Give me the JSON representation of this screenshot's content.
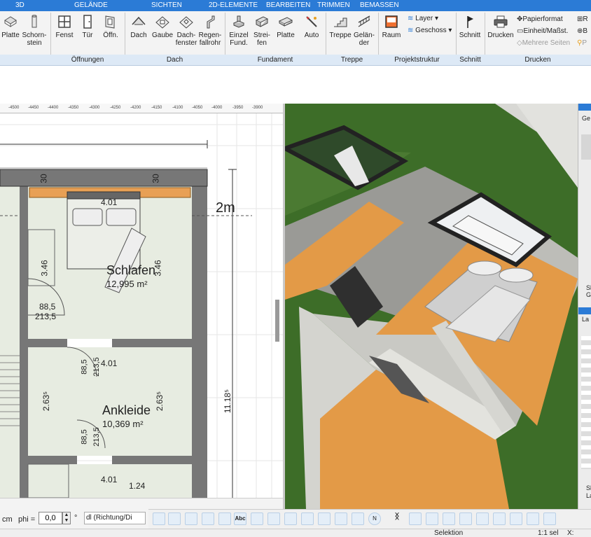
{
  "menu_tabs": [
    "3D",
    "GELÄNDE",
    "SICHTEN",
    "2D-ELEMENTE",
    "BEARBEITEN",
    "TRIMMEN",
    "BEMASSEN"
  ],
  "ribbon": {
    "buttons": [
      {
        "label": "Platte",
        "icon": "slab-icon"
      },
      {
        "label": "Schorn-\nstein",
        "icon": "chimney-icon"
      },
      {
        "label": "Fenst",
        "icon": "window-icon"
      },
      {
        "label": "Tür",
        "icon": "door-icon"
      },
      {
        "label": "Öffn.",
        "icon": "opening-icon"
      },
      {
        "label": "Dach",
        "icon": "roof-icon"
      },
      {
        "label": "Gaube",
        "icon": "dormer-icon"
      },
      {
        "label": "Dach-\nfenster",
        "icon": "roof-window-icon"
      },
      {
        "label": "Regen-\nfallrohr",
        "icon": "downpipe-icon"
      },
      {
        "label": "Einzel\nFund.",
        "icon": "single-foundation-icon"
      },
      {
        "label": "Strei-\nfen",
        "icon": "strip-foundation-icon"
      },
      {
        "label": "Platte",
        "icon": "foundation-slab-icon"
      },
      {
        "label": "Auto",
        "icon": "auto-icon"
      },
      {
        "label": "Treppe",
        "icon": "stairs-icon"
      },
      {
        "label": "Gelän-\nder",
        "icon": "railing-icon"
      },
      {
        "label": "Raum",
        "icon": "room-icon"
      },
      {
        "label": "Schnitt",
        "icon": "section-icon"
      },
      {
        "label": "Drucken",
        "icon": "printer-icon"
      }
    ],
    "small": {
      "layer": "Layer ▾",
      "geschoss": "Geschoss ▾",
      "papierformat": "Papierformat",
      "einheit": "Einheit/Maßst.",
      "mehrere_seiten": "Mehrere Seiten",
      "r": "R",
      "b": "B",
      "p": "P"
    },
    "groups": [
      "Öffnungen",
      "Dach",
      "Fundament",
      "Treppe",
      "Projektstruktur",
      "Schnitt",
      "Drucken"
    ]
  },
  "ruler_ticks": [
    "-4500",
    "-4450",
    "-4400",
    "-4350",
    "-4300",
    "-4250",
    "-4200",
    "-4150",
    "-4100",
    "-4050",
    "-4000",
    "-3950",
    "-3900"
  ],
  "plan": {
    "room1_name": "Schlafen",
    "room1_area": "12,995 m²",
    "room2_name": "Ankleide",
    "room2_area": "10,369 m²",
    "dims": {
      "d30a": "30",
      "d30b": "30",
      "d401a": "4.01",
      "d346a": "3.46",
      "d346b": "3.46",
      "d885a": "88,5",
      "d2135a": "213,5",
      "d885b": "88,5",
      "d2135b": "213,5",
      "d401b": "4.01",
      "d2635a": "2.63⁵",
      "d2635b": "2.63⁵",
      "d885c": "88,5",
      "d2135c": "213,5",
      "d401c": "4.01",
      "d124": "1.24",
      "d1118": "11.18⁵",
      "d2m": "2m"
    }
  },
  "bottom": {
    "unit": "cm",
    "phi_label": "phi =",
    "phi_value": "0,0",
    "deg": "°",
    "dl_select": "dl (Richtung/Di"
  },
  "rpanel": {
    "ge": "Ge",
    "la": "La",
    "s1": "Sl",
    "g1": "G",
    "s2": "Sl",
    "l2": "La"
  },
  "status": {
    "mode": "Selektion",
    "scale": "1:1 sel",
    "x": "X:"
  },
  "colors": {
    "accent": "#2b7bd6",
    "floor_wood": "#e39a47",
    "grass": "#3f6f2a",
    "wall_3d": "#c9c9c4"
  }
}
